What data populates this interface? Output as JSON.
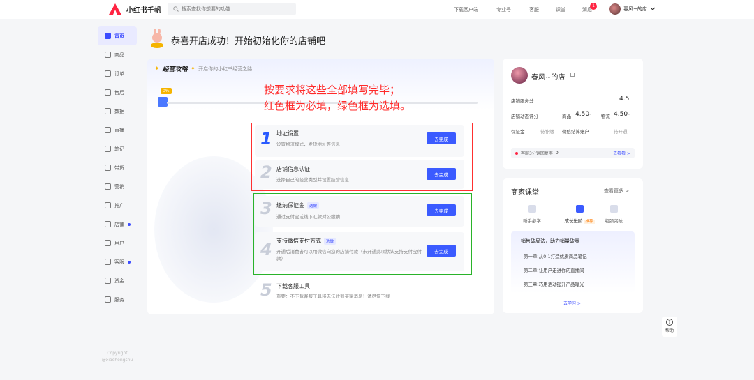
{
  "topbar": {
    "app_name": "小红书千帆",
    "search_placeholder": "搜索查找你想要的功能",
    "nav": [
      "下载客户端",
      "专业号",
      "客服",
      "课堂",
      "消息"
    ],
    "message_count": "1",
    "user_name": "春风~的店"
  },
  "sidebar": {
    "items": [
      {
        "label": "首页",
        "active": true
      },
      {
        "label": "商品"
      },
      {
        "label": "订单"
      },
      {
        "label": "售后"
      },
      {
        "label": "数据"
      },
      {
        "label": "直播"
      },
      {
        "label": "笔记"
      },
      {
        "label": "带货"
      },
      {
        "label": "营销"
      },
      {
        "label": "推广"
      },
      {
        "label": "店铺",
        "dot": true
      },
      {
        "label": "用户"
      },
      {
        "label": "客服",
        "dot": true
      },
      {
        "label": "资金"
      },
      {
        "label": "服务"
      }
    ],
    "copyright_line1": "Copyright",
    "copyright_line2": "@xiaohongshu"
  },
  "page_title": "恭喜开店成功！开始初始化你的店铺吧",
  "guide": {
    "title": "经营攻略",
    "subtitle": "开启你的小红书经营之路",
    "progress": "0%",
    "progress_value": 0,
    "annotation_line1": "按要求将这些全部填写完毕；",
    "annotation_line2": "红色框为必填，绿色框为选填。",
    "steps": [
      {
        "num": "1",
        "title": "地址设置",
        "desc": "设置物流模式，发货地址等信息",
        "button": "去完成"
      },
      {
        "num": "2",
        "title": "店铺信息认证",
        "desc": "选择自己的经营类型并设置经营信息",
        "button": "去完成"
      },
      {
        "num": "3",
        "title": "缴纳保证金",
        "tag": "选做",
        "desc": "通过支付宝或线下汇款对公缴纳",
        "button": "去完成"
      },
      {
        "num": "4",
        "title": "支持微信支付方式",
        "tag": "选做",
        "desc": "开通后消费者可以用微信向您的店铺付款（未开通此项默认支持支付宝付款）",
        "button": "去完成"
      },
      {
        "num": "5",
        "title": "下载客服工具",
        "desc": "重要：不下载客服工具将无法收到买家消息！请尽快下载"
      }
    ]
  },
  "store": {
    "name": "春风~的店",
    "service_label": "店铺服务分",
    "service_score": "4.5",
    "dynamic_label": "店铺动态评分",
    "goods_label": "商品",
    "goods_score": "4.50-",
    "logistics_label": "物流",
    "logistics_score": "4.50-",
    "deposit_label": "保证金",
    "deposit_status": "待补缴",
    "wechat_label": "微信结算账户",
    "wechat_status": "待开通",
    "notice_text": "客服3分钟回复率",
    "notice_value": "0",
    "notice_link": "去看看 >"
  },
  "class": {
    "title": "商家课堂",
    "more": "查看更多 >",
    "tabs": [
      "新手必学",
      "成长进阶",
      "瓶颈突破"
    ],
    "tab_tag": "推荐",
    "course_head": "销售破局法，助力销量破零",
    "courses": [
      "第一章 从0-1打造优质商品笔记",
      "第二章 让用户走进你的直播间",
      "第三章 巧用活动提升产品曝光"
    ],
    "link": "去学习 >"
  },
  "help_label": "帮助",
  "colors": {
    "accent": "#3b5bff",
    "brand_red": "#ff2442",
    "required_box": "#ff3030",
    "optional_box": "#2ab32a"
  }
}
